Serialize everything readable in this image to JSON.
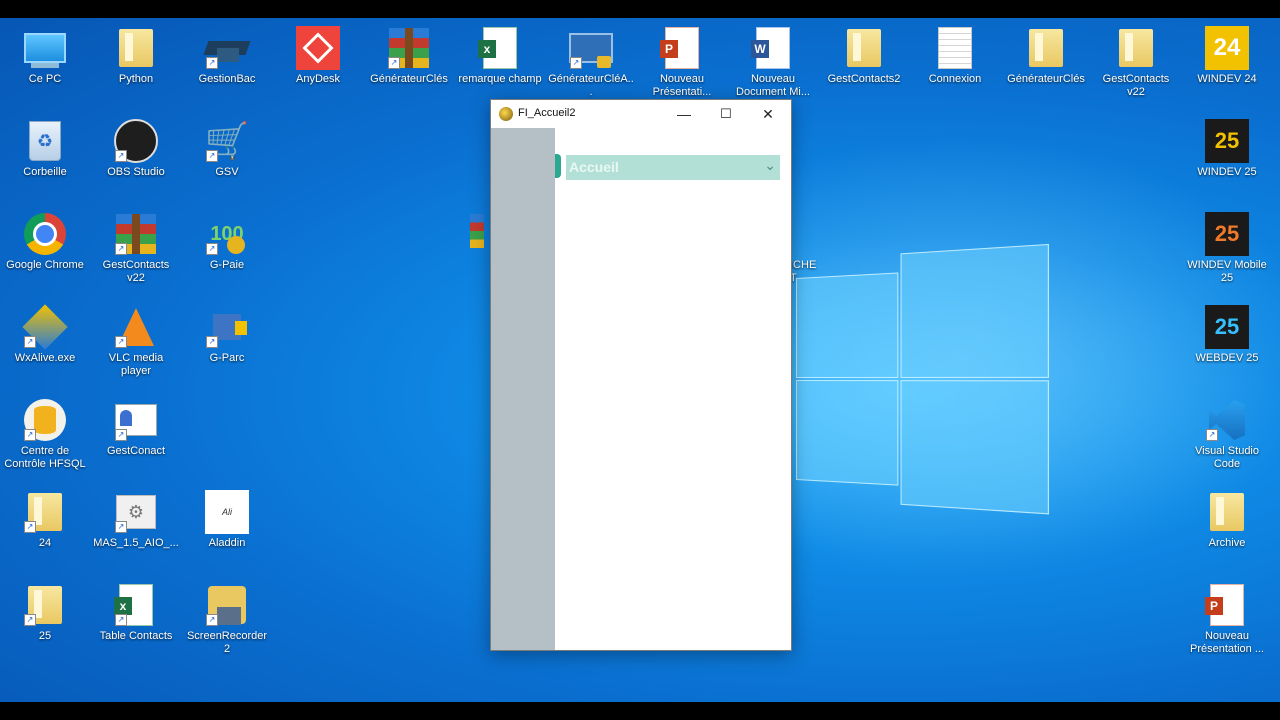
{
  "desktop": {
    "icons": [
      {
        "label": "Ce PC",
        "icon": "computer-icon"
      },
      {
        "label": "Python",
        "icon": "folder-icon"
      },
      {
        "label": "GestionBac",
        "icon": "graduation-cap-icon"
      },
      {
        "label": "AnyDesk",
        "icon": "anydesk-icon"
      },
      {
        "label": "GénérateurClés",
        "icon": "winrar-icon"
      },
      {
        "label": "remarque champ",
        "icon": "excel-icon"
      },
      {
        "label": "GénérateurCléA...",
        "icon": "network-lock-icon"
      },
      {
        "label": "Nouveau Présentati...",
        "icon": "powerpoint-icon"
      },
      {
        "label": "Nouveau Document Mi...",
        "icon": "word-icon"
      },
      {
        "label": "GestContacts2",
        "icon": "folder-icon"
      },
      {
        "label": "Connexion",
        "icon": "text-document-icon"
      },
      {
        "label": "GénérateurClés",
        "icon": "folder-icon"
      },
      {
        "label": "GestContacts v22",
        "icon": "folder-icon"
      },
      {
        "label": "WINDEV 24",
        "icon": "windev24-icon"
      },
      {
        "label": "Corbeille",
        "icon": "recycle-bin-icon"
      },
      {
        "label": "OBS Studio",
        "icon": "obs-icon"
      },
      {
        "label": "GSV",
        "icon": "shopping-cart-icon"
      },
      {
        "label": "WINDEV 25",
        "icon": "windev25-icon"
      },
      {
        "label": "Google Chrome",
        "icon": "chrome-icon"
      },
      {
        "label": "GestContacts v22",
        "icon": "winrar-icon"
      },
      {
        "label": "G-Paie",
        "icon": "coins-icon"
      },
      {
        "label": "WINDEV Mobile 25",
        "icon": "windev-mobile-icon"
      },
      {
        "label": "WxAlive.exe",
        "icon": "wxalive-icon"
      },
      {
        "label": "VLC media player",
        "icon": "vlc-icon"
      },
      {
        "label": "G-Parc",
        "icon": "truck-icon"
      },
      {
        "label": "WEBDEV 25",
        "icon": "webdev-icon"
      },
      {
        "label": "Centre de Contrôle HFSQL",
        "icon": "hfsql-icon"
      },
      {
        "label": "GestConact",
        "icon": "contact-card-icon"
      },
      {
        "label": "Visual Studio Code",
        "icon": "vscode-icon"
      },
      {
        "label": "24",
        "icon": "folder-icon"
      },
      {
        "label": "MAS_1.5_AIO_...",
        "icon": "settings-folder-icon"
      },
      {
        "label": "Aladdin",
        "icon": "aladdin-icon"
      },
      {
        "label": "Archive",
        "icon": "folder-icon"
      },
      {
        "label": "25",
        "icon": "folder-icon"
      },
      {
        "label": "Table Contacts",
        "icon": "excel-icon"
      },
      {
        "label": "ScreenRecorder2",
        "icon": "floppy-folder-icon"
      },
      {
        "label": "Nouveau Présentation ...",
        "icon": "powerpoint-icon"
      }
    ],
    "partial_label": "ICHE\nT"
  },
  "window": {
    "title": "FI_Accueil2",
    "minimize_symbol": "—",
    "maximize_symbol": "☐",
    "close_symbol": "✕",
    "combo": {
      "selected": "Accueil",
      "arrow": "⌄"
    }
  },
  "colors": {
    "sidebar": "#b5bfc6",
    "combo_bg": "#b3e0d6",
    "accent": "#2aa890"
  }
}
